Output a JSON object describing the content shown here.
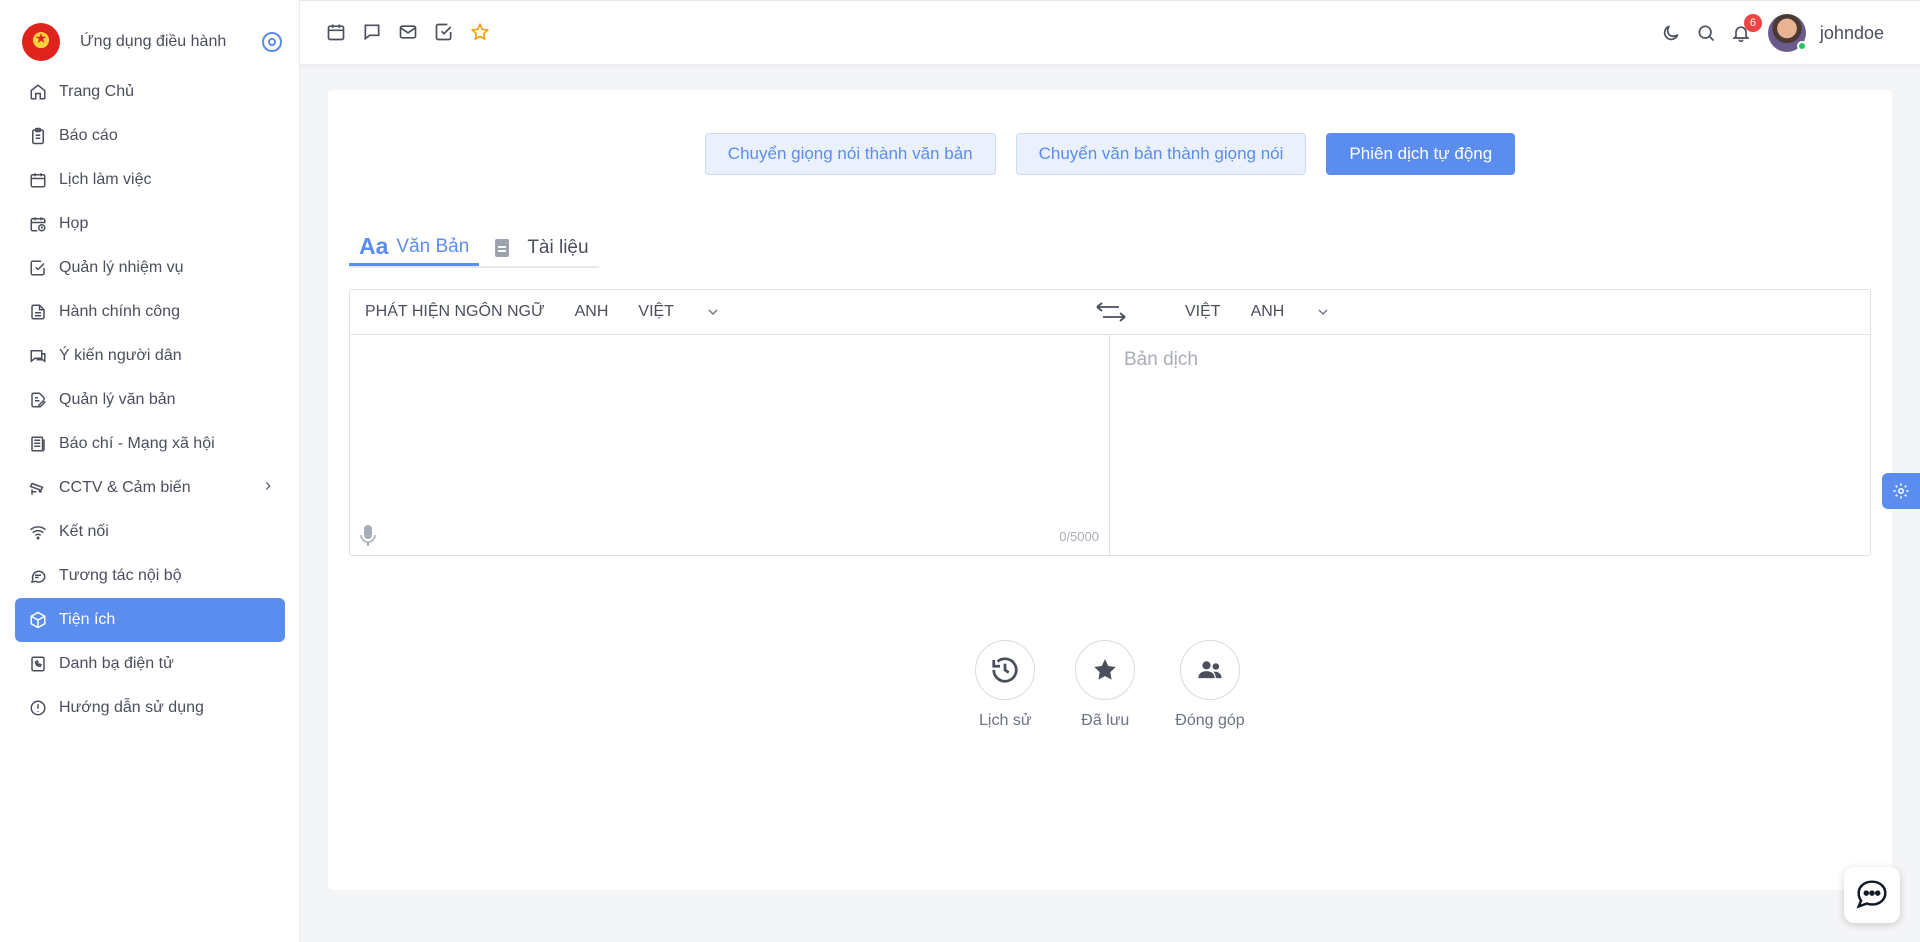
{
  "brand": {
    "name": "Ứng dụng điều hành",
    "logo_icon": "national-emblem-icon"
  },
  "sidebar": {
    "items": [
      {
        "label": "Trang Chủ",
        "icon": "home-icon"
      },
      {
        "label": "Báo cáo",
        "icon": "clipboard-icon"
      },
      {
        "label": "Lịch làm việc",
        "icon": "calendar-icon"
      },
      {
        "label": "Họp",
        "icon": "calendar-clock-icon"
      },
      {
        "label": "Quản lý nhiệm vụ",
        "icon": "checkbox-icon"
      },
      {
        "label": "Hành chính công",
        "icon": "document-icon"
      },
      {
        "label": "Ý kiến người dân",
        "icon": "chat-icon"
      },
      {
        "label": "Quản lý văn bản",
        "icon": "document-edit-icon"
      },
      {
        "label": "Báo chí - Mạng xã hội",
        "icon": "newspaper-icon"
      },
      {
        "label": "CCTV & Cảm biến",
        "icon": "cctv-icon"
      },
      {
        "label": "Kết nối",
        "icon": "wifi-icon"
      },
      {
        "label": "Tương tác nội bộ",
        "icon": "messages-icon"
      },
      {
        "label": "Tiện ích",
        "icon": "cube-icon",
        "active": true
      },
      {
        "label": "Danh bạ điện tử",
        "icon": "phonebook-icon"
      },
      {
        "label": "Hướng dẫn sử dụng",
        "icon": "info-icon"
      }
    ]
  },
  "topbar": {
    "quick_icons": [
      "calendar-icon",
      "chat-icon",
      "mail-icon",
      "checkbox-icon",
      "star-icon"
    ],
    "notification_count": "6",
    "username": "johndoe"
  },
  "modes": {
    "speech_to_text": "Chuyển giọng nói thành văn bản",
    "text_to_speech": "Chuyển văn bản thành giọng nói",
    "auto_translate": "Phiên dịch tự động"
  },
  "tabs": {
    "text_prefix": "Aa",
    "text": "Văn Bản",
    "document": "Tài liệu"
  },
  "translator": {
    "source_langs": [
      "PHÁT HIỆN NGÔN NGỮ",
      "ANH",
      "VIỆT"
    ],
    "target_langs": [
      "VIỆT",
      "ANH"
    ],
    "source_text": "",
    "char_counter": "0/5000",
    "target_placeholder": "Bản dịch"
  },
  "actions": {
    "history": "Lịch sử",
    "saved": "Đã lưu",
    "contribute": "Đóng góp"
  },
  "colors": {
    "accent": "#5b8def",
    "star": "#f59e0b",
    "badge": "#ef4444",
    "online": "#22c55e"
  }
}
